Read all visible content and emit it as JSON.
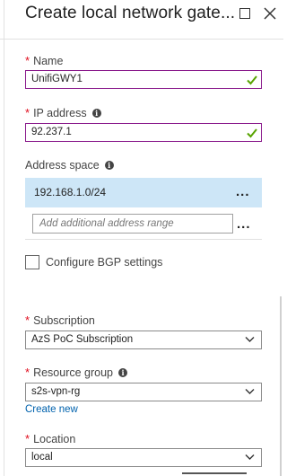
{
  "header": {
    "title": "Create local network gate...",
    "maximize_icon": "maximize-icon",
    "close_icon": "close-icon"
  },
  "form": {
    "required_marker": "*",
    "name": {
      "label": "Name",
      "value": "UnifiGWY1"
    },
    "ip_address": {
      "label": "IP address",
      "value": "92.237.1"
    },
    "address_space": {
      "label": "Address space",
      "ranges": [
        "192.168.1.0/24"
      ],
      "add_placeholder": "Add additional address range",
      "more_label": "..."
    },
    "bgp": {
      "label": "Configure BGP settings",
      "checked": false
    },
    "subscription": {
      "label": "Subscription",
      "value": "AzS PoC Subscription"
    },
    "resource_group": {
      "label": "Resource group",
      "value": "s2s-vpn-rg",
      "create_new": "Create new"
    },
    "location": {
      "label": "Location",
      "value": "local"
    },
    "info_glyph": "i"
  },
  "colors": {
    "required": "#e00b1c",
    "valid_check": "#57a300",
    "focus_border": "#8a1b8c",
    "selected_row": "#cde6f7",
    "link": "#0062ad"
  }
}
